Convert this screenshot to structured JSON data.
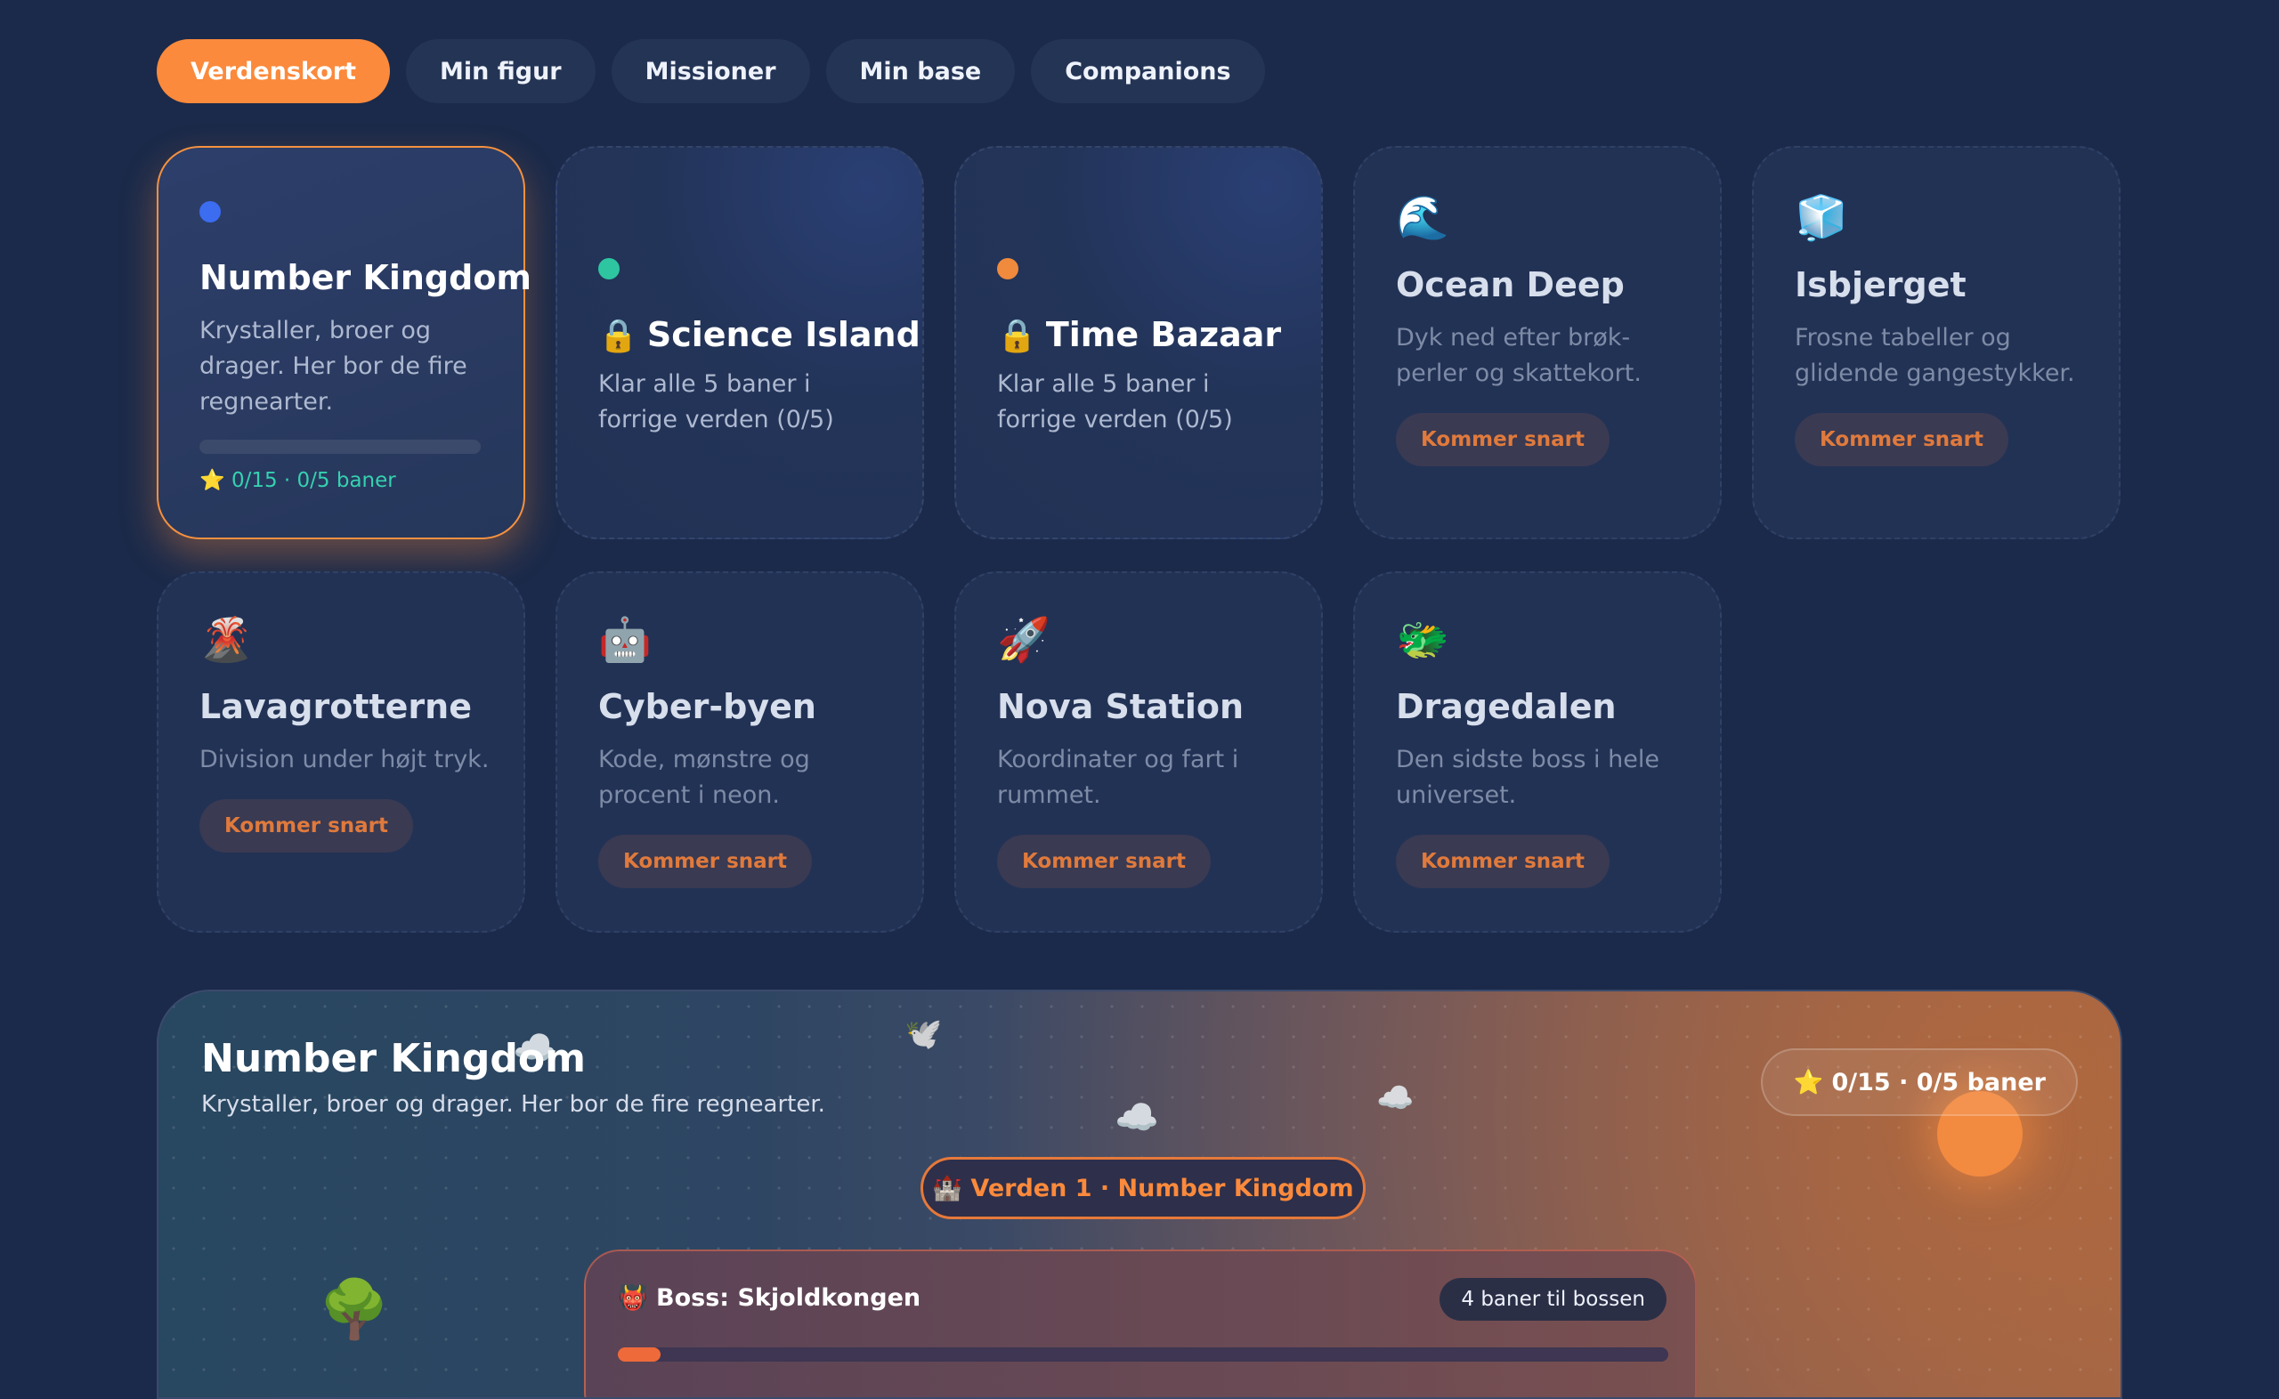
{
  "tabs": [
    {
      "label": "Verdenskort",
      "active": true
    },
    {
      "label": "Min figur",
      "active": false
    },
    {
      "label": "Missioner",
      "active": false
    },
    {
      "label": "Min base",
      "active": false
    },
    {
      "label": "Companions",
      "active": false
    }
  ],
  "worlds": {
    "number_kingdom": {
      "title": "Number Kingdom",
      "desc": "Krystaller, broer og drager. Her bor de fire regnearter.",
      "progress_label": "⭐ 0/15 · 0/5 baner",
      "progress": 0,
      "dot_color": "#3c6cf0"
    },
    "science_island": {
      "title": "Science Island",
      "desc": "Klar alle 5 baner i forrige verden (0/5)",
      "dot_color": "#2ec6a0"
    },
    "time_bazaar": {
      "title": "Time Bazaar",
      "desc": "Klar alle 5 baner i forrige verden (0/5)",
      "dot_color": "#f08a3c"
    },
    "ocean_deep": {
      "icon": "🌊",
      "title": "Ocean Deep",
      "desc": "Dyk ned efter brøk-perler og skattekort.",
      "button": "Kommer snart"
    },
    "isbjerget": {
      "icon": "🧊",
      "title": "Isbjerget",
      "desc": "Frosne tabeller og glidende gangestykker.",
      "button": "Kommer snart"
    },
    "lavagrotterne": {
      "icon": "🌋",
      "title": "Lavagrotterne",
      "desc": "Division under højt tryk.",
      "button": "Kommer snart"
    },
    "cyber_byen": {
      "icon": "🤖",
      "title": "Cyber-byen",
      "desc": "Kode, mønstre og procent i neon.",
      "button": "Kommer snart"
    },
    "nova_station": {
      "icon": "🚀",
      "title": "Nova Station",
      "desc": "Koordinater og fart i rummet.",
      "button": "Kommer snart"
    },
    "dragedalen": {
      "icon": "🐲",
      "title": "Dragedalen",
      "desc": "Den sidste boss i hele universet.",
      "button": "Kommer snart"
    }
  },
  "lock_icon": "🔒",
  "map": {
    "title": "Number Kingdom",
    "subtitle": "Krystaller, broer og drager. Her bor de fire regnearter.",
    "score": "⭐ 0/15 · 0/5 baner",
    "world_label": "🏰 Verden 1 · Number Kingdom",
    "boss_title": "👹 Boss: Skjoldkongen",
    "boss_count": "4 baner til bossen",
    "decorations": {
      "cloud": "☁️",
      "bird": "🕊️",
      "tree": "🌳"
    }
  },
  "colors": {
    "background": "#1b2a4a",
    "accent": "#fb8a3c",
    "teal": "#35d1b0"
  }
}
